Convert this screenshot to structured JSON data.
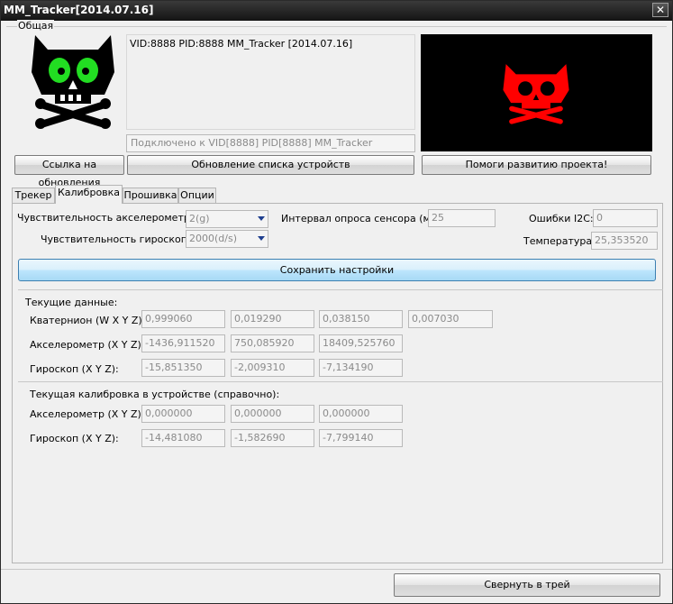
{
  "window": {
    "title": "MM_Tracker[2014.07.16]",
    "close_glyph": "✕"
  },
  "general": {
    "group_label": "Общая",
    "device_info": "VID:8888 PID:8888 MM_Tracker [2014.07.16]",
    "connection_status": "Подключено к VID[8888] PID[8888] MM_Tracker",
    "update_link_button": "Ссылка на обновления",
    "refresh_devices_button": "Обновление списка устройств",
    "donate_button": "Помоги развитию проекта!"
  },
  "tabs": [
    {
      "label": "Трекер",
      "active": false
    },
    {
      "label": "Калибровка",
      "active": true
    },
    {
      "label": "Прошивка",
      "active": false
    },
    {
      "label": "Опции",
      "active": false
    }
  ],
  "settings": {
    "accel_sens_label": "Чувствительность акселерометра:",
    "accel_sens_value": "2(g)",
    "gyro_sens_label": "Чувствительность гироскопа:",
    "gyro_sens_value": "2000(d/s)",
    "poll_interval_label": "Интервал опроса сенсора (мс):",
    "poll_interval_value": "25",
    "i2c_errors_label": "Ошибки I2C:",
    "i2c_errors_value": "0",
    "temperature_label": "Температура:",
    "temperature_value": "25,353520",
    "save_button": "Сохранить настройки"
  },
  "current_data": {
    "heading": "Текущие данные:",
    "quaternion_label": "Кватернион (W X Y Z):",
    "quaternion": [
      "0,999060",
      "0,019290",
      "0,038150",
      "0,007030"
    ],
    "accel_label": "Акселерометр (X Y Z):",
    "accel": [
      "-1436,911520",
      "750,085920",
      "18409,525760"
    ],
    "gyro_label": "Гироскоп (X Y Z):",
    "gyro": [
      "-15,851350",
      "-2,009310",
      "-7,134190"
    ]
  },
  "device_calibration": {
    "heading": "Текущая калибровка в устройстве (справочно):",
    "accel_label": "Акселерометр (X Y Z):",
    "accel": [
      "0,000000",
      "0,000000",
      "0,000000"
    ],
    "gyro_label": "Гироскоп (X Y Z):",
    "gyro": [
      "-14,481080",
      "-1,582690",
      "-7,799140"
    ]
  },
  "footer": {
    "minimize_button": "Свернуть в трей"
  },
  "colors": {
    "left_logo_eyes": "#22dd22",
    "right_logo": "#ff0000",
    "titlebar": "#1e1e1e",
    "accent": "#1f3f8f"
  }
}
